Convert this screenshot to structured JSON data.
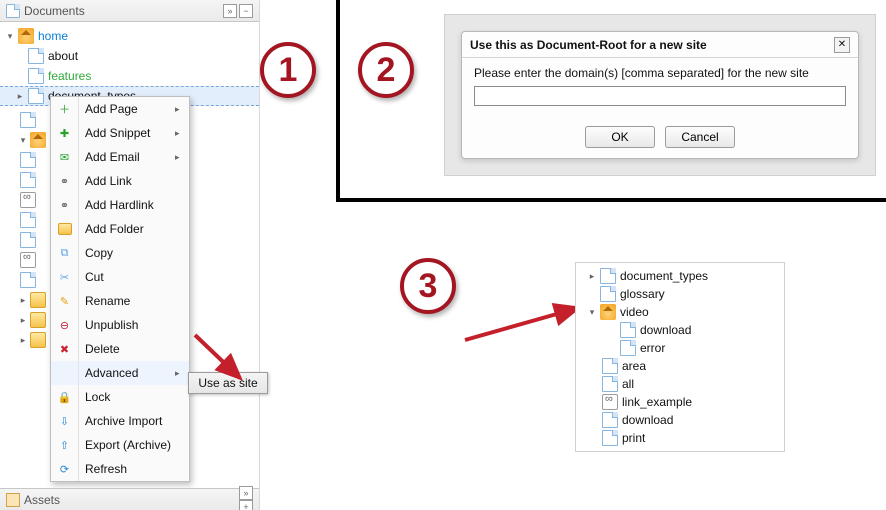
{
  "panel": {
    "title": "Documents",
    "assets_title": "Assets"
  },
  "tree": {
    "home": "home",
    "about": "about",
    "features": "features",
    "document_types": "document_types"
  },
  "ctx_menu": {
    "add_page": "Add Page",
    "add_snippet": "Add Snippet",
    "add_email": "Add Email",
    "add_link": "Add Link",
    "add_hardlink": "Add Hardlink",
    "add_folder": "Add Folder",
    "copy": "Copy",
    "cut": "Cut",
    "rename": "Rename",
    "unpublish": "Unpublish",
    "delete": "Delete",
    "advanced": "Advanced",
    "lock": "Lock",
    "archive_import": "Archive Import",
    "export_archive": "Export (Archive)",
    "refresh": "Refresh"
  },
  "submenu": {
    "use_as_site": "Use as site"
  },
  "dialog": {
    "title": "Use this as Document-Root for a new site",
    "prompt": "Please enter the domain(s) [comma separated] for the new site",
    "value": "",
    "ok": "OK",
    "cancel": "Cancel"
  },
  "result_tree": {
    "document_types": "document_types",
    "glossary": "glossary",
    "video": "video",
    "download": "download",
    "error": "error",
    "area": "area",
    "all": "all",
    "link_example": "link_example",
    "download2": "download",
    "print": "print"
  },
  "steps": {
    "one": "1",
    "two": "2",
    "three": "3"
  }
}
